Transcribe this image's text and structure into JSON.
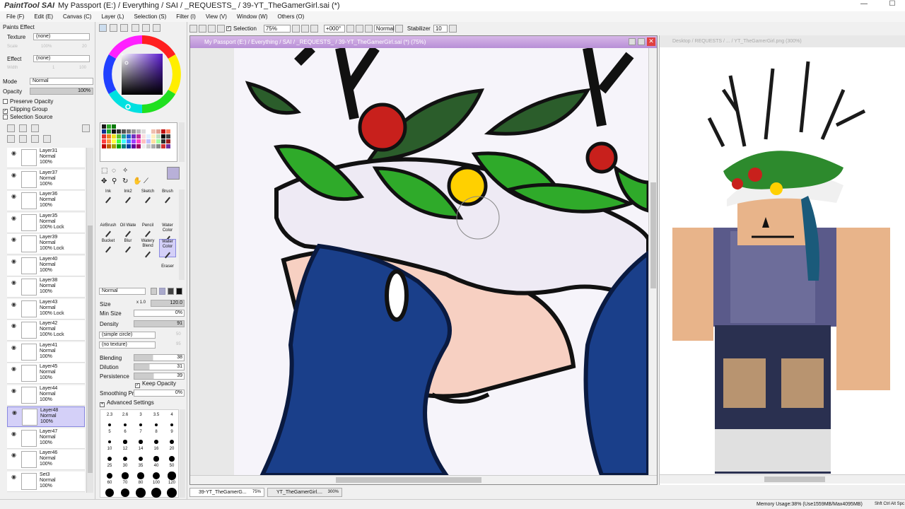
{
  "titlebar": {
    "app_logo": "PaintTool SAI",
    "title": "My Passport (E:) / Everything / SAI / _REQUESTS_ / 39-YT_TheGamerGirl.sai (*)",
    "minimize": "—",
    "maximize": "☐"
  },
  "menu": {
    "items": [
      "File (F)",
      "Edit (E)",
      "Canvas (C)",
      "Layer (L)",
      "Selection (S)",
      "Filter (I)",
      "View (V)",
      "Window (W)",
      "Others (O)"
    ]
  },
  "toolbar": {
    "selection_label": "Selection",
    "zoom": "75%",
    "rotation": "+000°",
    "blend": "Normal",
    "stabilizer_label": "Stabilizer",
    "stabilizer_value": "10"
  },
  "paints_effect": {
    "header": "Paints Effect",
    "texture_label": "Texture",
    "texture_value": "(none)",
    "scale_label": "Scale",
    "scale_value": "100%",
    "scale_num": "20",
    "effect_label": "Effect",
    "effect_value": "(none)",
    "width_label": "Width",
    "width_num": "1",
    "width_value": "100",
    "mode_label": "Mode",
    "mode_value": "Normal",
    "opacity_label": "Opacity",
    "opacity_value": "100%",
    "preserve_opacity": "Preserve Opacity",
    "clipping_group": "Clipping Group",
    "selection_source": "Selection Source"
  },
  "layers": [
    {
      "name": "Layer31",
      "mode": "Normal",
      "opacity": "100%",
      "extra": ""
    },
    {
      "name": "Layer37",
      "mode": "Normal",
      "opacity": "100%",
      "extra": ""
    },
    {
      "name": "Layer36",
      "mode": "Normal",
      "opacity": "100%",
      "extra": ""
    },
    {
      "name": "Layer35",
      "mode": "Normal",
      "opacity": "100%",
      "extra": "Lock"
    },
    {
      "name": "Layer39",
      "mode": "Normal",
      "opacity": "100%",
      "extra": "Lock"
    },
    {
      "name": "Layer40",
      "mode": "Normal",
      "opacity": "100%",
      "extra": ""
    },
    {
      "name": "Layer38",
      "mode": "Normal",
      "opacity": "100%",
      "extra": ""
    },
    {
      "name": "Layer43",
      "mode": "Normal",
      "opacity": "100%",
      "extra": "Lock"
    },
    {
      "name": "Layer42",
      "mode": "Normal",
      "opacity": "100%",
      "extra": "Lock"
    },
    {
      "name": "Layer41",
      "mode": "Normal",
      "opacity": "100%",
      "extra": ""
    },
    {
      "name": "Layer45",
      "mode": "Normal",
      "opacity": "100%",
      "extra": ""
    },
    {
      "name": "Layer44",
      "mode": "Normal",
      "opacity": "100%",
      "extra": ""
    },
    {
      "name": "Layer48",
      "mode": "Normal",
      "opacity": "100%",
      "extra": ""
    },
    {
      "name": "Layer47",
      "mode": "Normal",
      "opacity": "100%",
      "extra": ""
    },
    {
      "name": "Layer46",
      "mode": "Normal",
      "opacity": "100%",
      "extra": ""
    },
    {
      "name": "Set3",
      "mode": "Normal",
      "opacity": "100%",
      "extra": ""
    }
  ],
  "tools": {
    "brushes": [
      "Ink",
      "Ink2",
      "Sketch",
      "Brush",
      "AirBrush",
      "Oil Wate",
      "Pencil",
      "Water Color",
      "Bucket",
      "Blur",
      "Watery Blend",
      "Water Color",
      "Eraser"
    ],
    "blend_mode": "Normal",
    "size_label": "Size",
    "size_mult": "x 1.0",
    "size_value": "120.0",
    "min_size_label": "Min Size",
    "min_size_value": "0%",
    "density_label": "Density",
    "density_value": "91",
    "shape": "(simple circle)",
    "shape_num": "50",
    "texture": "(no texture)",
    "texture_num": "95",
    "blending_label": "Blending",
    "blending_value": "38",
    "dilution_label": "Dilution",
    "dilution_value": "31",
    "persistence_label": "Persistence",
    "persistence_value": "39",
    "keep_opacity": "Keep Opacity",
    "smoothing_label": "Smoothing Prs",
    "smoothing_value": "0%",
    "advanced": "Advanced Settings",
    "size_presets": [
      "2.3",
      "2.6",
      "3",
      "3.5",
      "4",
      "5",
      "6",
      "7",
      "8",
      "9",
      "10",
      "12",
      "14",
      "16",
      "20",
      "25",
      "30",
      "35",
      "40",
      "50",
      "60",
      "70",
      "80",
      "100",
      "120"
    ]
  },
  "main_window": {
    "title": "My Passport (E:) / Everything / SAI / _REQUESTS_ / 39-YT_TheGamerGirl.sai (*) (75%)"
  },
  "secondary_window": {
    "title": "Desktop / REQUESTS / ... / YT_TheGamerGirl.png (300%)"
  },
  "tabs": [
    {
      "name": "39-YT_TheGamerG...",
      "zoom": "75%"
    },
    {
      "name": "YT_TheGamerGirl....",
      "zoom": "300%"
    }
  ],
  "status": {
    "memory": "Memory Usage:38% (Use1559MB/Max4095MB)",
    "keys": "Shft Ctrl Alt Spc"
  },
  "colors": {
    "window_accent": "#b88fd6",
    "layer_selected": "#d4d0f8",
    "hair_blue": "#1a3f8a",
    "leaf_green": "#2faa2a",
    "berry_red": "#c8201c"
  }
}
